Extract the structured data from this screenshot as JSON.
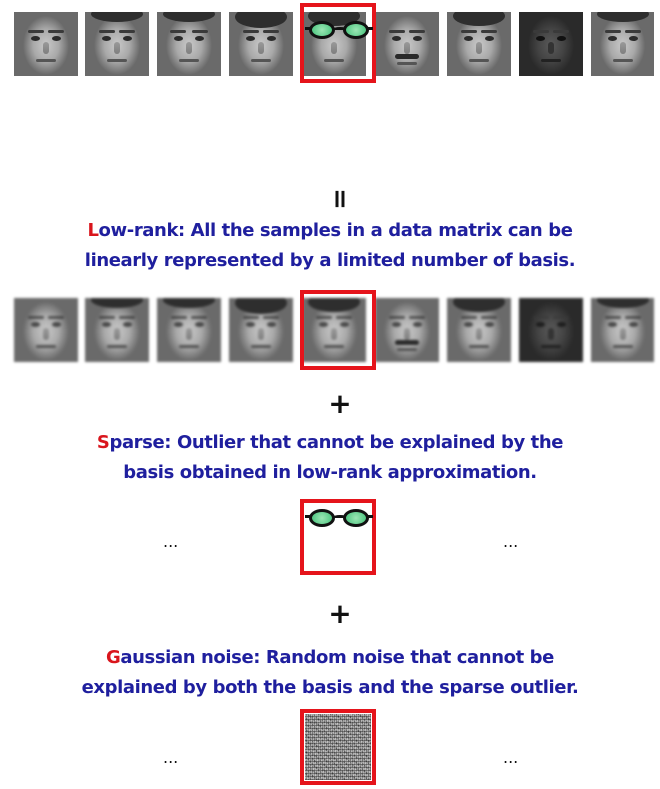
{
  "equals_sign": "=",
  "plus_sign_1": "+",
  "plus_sign_2": "+",
  "low_rank": {
    "lead_letter": "L",
    "line1_rest": "ow-rank: All the samples in a data matrix can be",
    "line2": "linearly represented by a limited number of basis."
  },
  "sparse": {
    "lead_letter": "S",
    "line1_rest": "parse: Outlier that cannot be explained by the",
    "line2": "basis obtained in low-rank approximation."
  },
  "gaussian": {
    "lead_letter": "G",
    "line1_rest": "aussian noise: Random noise that cannot be",
    "line2": "explained by both the basis and the sparse outlier."
  },
  "ellipsis": "...",
  "colors": {
    "highlight_border": "#e5141b",
    "text_blue": "#1f1f9e",
    "lead_red": "#d9151c",
    "glasses_lens": "#44c27a"
  }
}
